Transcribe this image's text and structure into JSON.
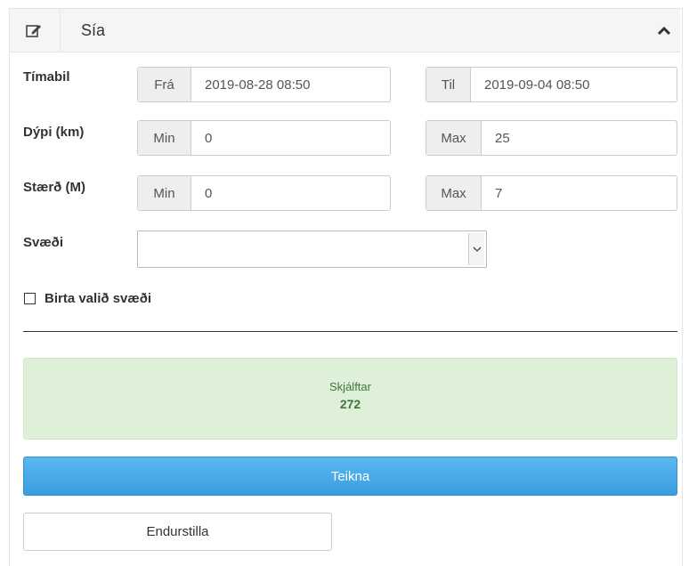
{
  "panel": {
    "title": "Sía",
    "edit_icon": "edit-icon",
    "collapse_icon": "chevron-up-icon"
  },
  "time": {
    "label": "Tímabil",
    "from_addon": "Frá",
    "from_value": "2019-08-28 08:50",
    "to_addon": "Til",
    "to_value": "2019-09-04 08:50"
  },
  "depth": {
    "label": "Dýpi (km)",
    "min_addon": "Min",
    "min_value": "0",
    "max_addon": "Max",
    "max_value": "25"
  },
  "magnitude": {
    "label": "Stærð (M)",
    "min_addon": "Min",
    "min_value": "0",
    "max_addon": "Max",
    "max_value": "7"
  },
  "region": {
    "label": "Svæði",
    "selected": ""
  },
  "show_region": {
    "label": "Birta valið svæði",
    "checked": false
  },
  "result": {
    "label": "Skjálftar",
    "count": "272"
  },
  "actions": {
    "draw_label": "Teikna",
    "reset_label": "Endurstilla"
  },
  "colors": {
    "primary": "#3a9de0",
    "success_bg": "#dff0d8",
    "success_text": "#3c763d"
  }
}
